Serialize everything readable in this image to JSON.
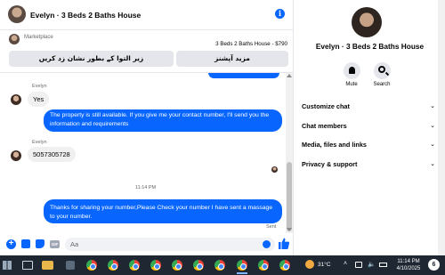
{
  "header": {
    "title": "Evelyn · 3 Beds 2 Baths House",
    "info_icon": "info-icon"
  },
  "marketplace": {
    "label": "Marketplace",
    "listing": "3 Beds 2 Baths House - $790",
    "button_1": "زیر التوا کے بطور نشان زد کریں",
    "button_2": "مزید آپشنز"
  },
  "messages": {
    "sender_1": "Evelyn",
    "incoming_1": "Yes",
    "outgoing_1": "The property is still available. If you give me your contact number, I'll send you the information and requirements",
    "sender_2": "Evelyn",
    "incoming_2": "5057305728",
    "time_separator": "11:14 PM",
    "outgoing_2": "Thanks for sharing your number,Please Check your number I have sent a massage to your number.",
    "status": "Sent"
  },
  "composer": {
    "placeholder": "Aa"
  },
  "right_panel": {
    "name": "Evelyn · 3 Beds 2 Baths House",
    "mute_label": "Mute",
    "search_label": "Search",
    "sections": [
      "Customize chat",
      "Chat members",
      "Media, files and links",
      "Privacy & support"
    ]
  },
  "taskbar": {
    "temperature": "31°C",
    "time": "11:14 PM",
    "date": "4/10/2025",
    "notifications": "6"
  },
  "colors": {
    "accent": "#0866ff",
    "bubble_in": "#f0f0f0",
    "taskbar": "#1f2733"
  }
}
